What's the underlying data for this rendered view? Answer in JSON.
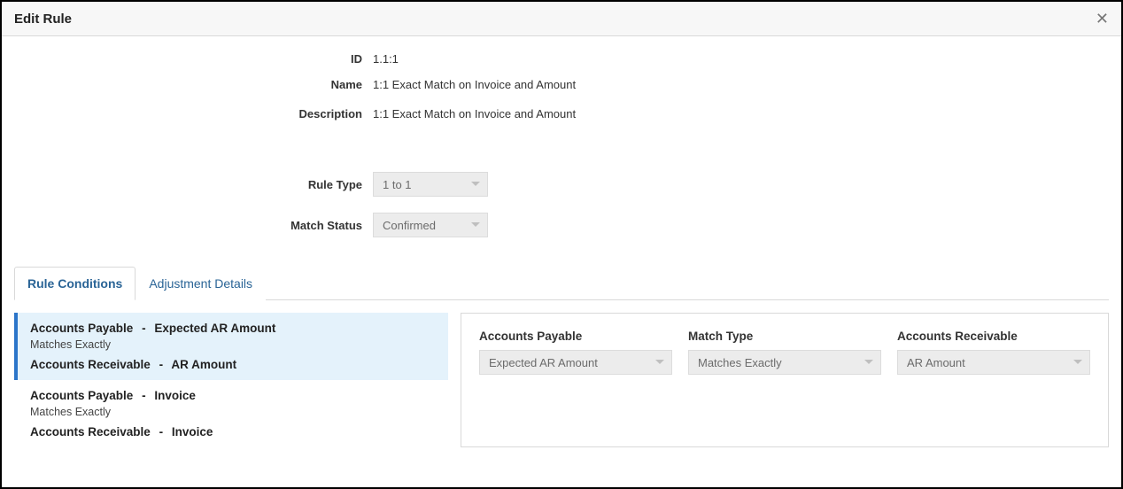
{
  "header": {
    "title": "Edit Rule"
  },
  "form": {
    "id_label": "ID",
    "id_value": "1.1:1",
    "name_label": "Name",
    "name_value": "1:1 Exact Match on Invoice and Amount",
    "description_label": "Description",
    "description_value": "1:1 Exact Match on Invoice and Amount",
    "rule_type_label": "Rule Type",
    "rule_type_value": "1 to 1",
    "match_status_label": "Match Status",
    "match_status_value": "Confirmed"
  },
  "tabs": {
    "rule_conditions": "Rule Conditions",
    "adjustment_details": "Adjustment Details"
  },
  "conditions": [
    {
      "ap_label": "Accounts Payable",
      "ap_field": "Expected AR Amount",
      "op": "Matches Exactly",
      "ar_label": "Accounts Receivable",
      "ar_field": "AR Amount",
      "selected": true
    },
    {
      "ap_label": "Accounts Payable",
      "ap_field": "Invoice",
      "op": "Matches Exactly",
      "ar_label": "Accounts Receivable",
      "ar_field": "Invoice",
      "selected": false
    }
  ],
  "detail": {
    "ap_label": "Accounts Payable",
    "ap_value": "Expected AR Amount",
    "match_type_label": "Match Type",
    "match_type_value": "Matches Exactly",
    "ar_label": "Accounts Receivable",
    "ar_value": "AR Amount"
  }
}
